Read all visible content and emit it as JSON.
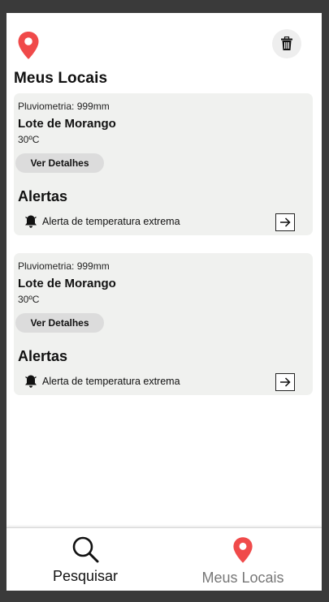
{
  "header": {
    "title": "Meus Locais",
    "logo_icon": "map-pin-icon",
    "delete_icon": "trash-icon"
  },
  "locations": [
    {
      "pluviometry": "Pluviometria: 999mm",
      "name": "Lote de Morango",
      "temperature": "30ºC",
      "details_label": "Ver Detalhes",
      "alerts_title": "Alertas",
      "alert_text": "Alerta de temperatura extrema",
      "alert_icon": "bell-icon",
      "action_icon": "arrow-right-icon"
    },
    {
      "pluviometry": "Pluviometria: 999mm",
      "name": "Lote de Morango",
      "temperature": "30ºC",
      "details_label": "Ver Detalhes",
      "alerts_title": "Alertas",
      "alert_text": "Alerta de temperatura extrema",
      "alert_icon": "bell-icon",
      "action_icon": "arrow-right-icon"
    }
  ],
  "bottom_nav": {
    "items": [
      {
        "label": "Pesquisar",
        "icon": "search-icon",
        "active": false
      },
      {
        "label": "Meus Locais",
        "icon": "map-pin-icon",
        "active": true
      }
    ]
  },
  "colors": {
    "pin_red": "#f04a4a",
    "card_bg": "#f0f1ef",
    "button_bg": "#dcdcdc",
    "inactive_label": "#777777"
  }
}
